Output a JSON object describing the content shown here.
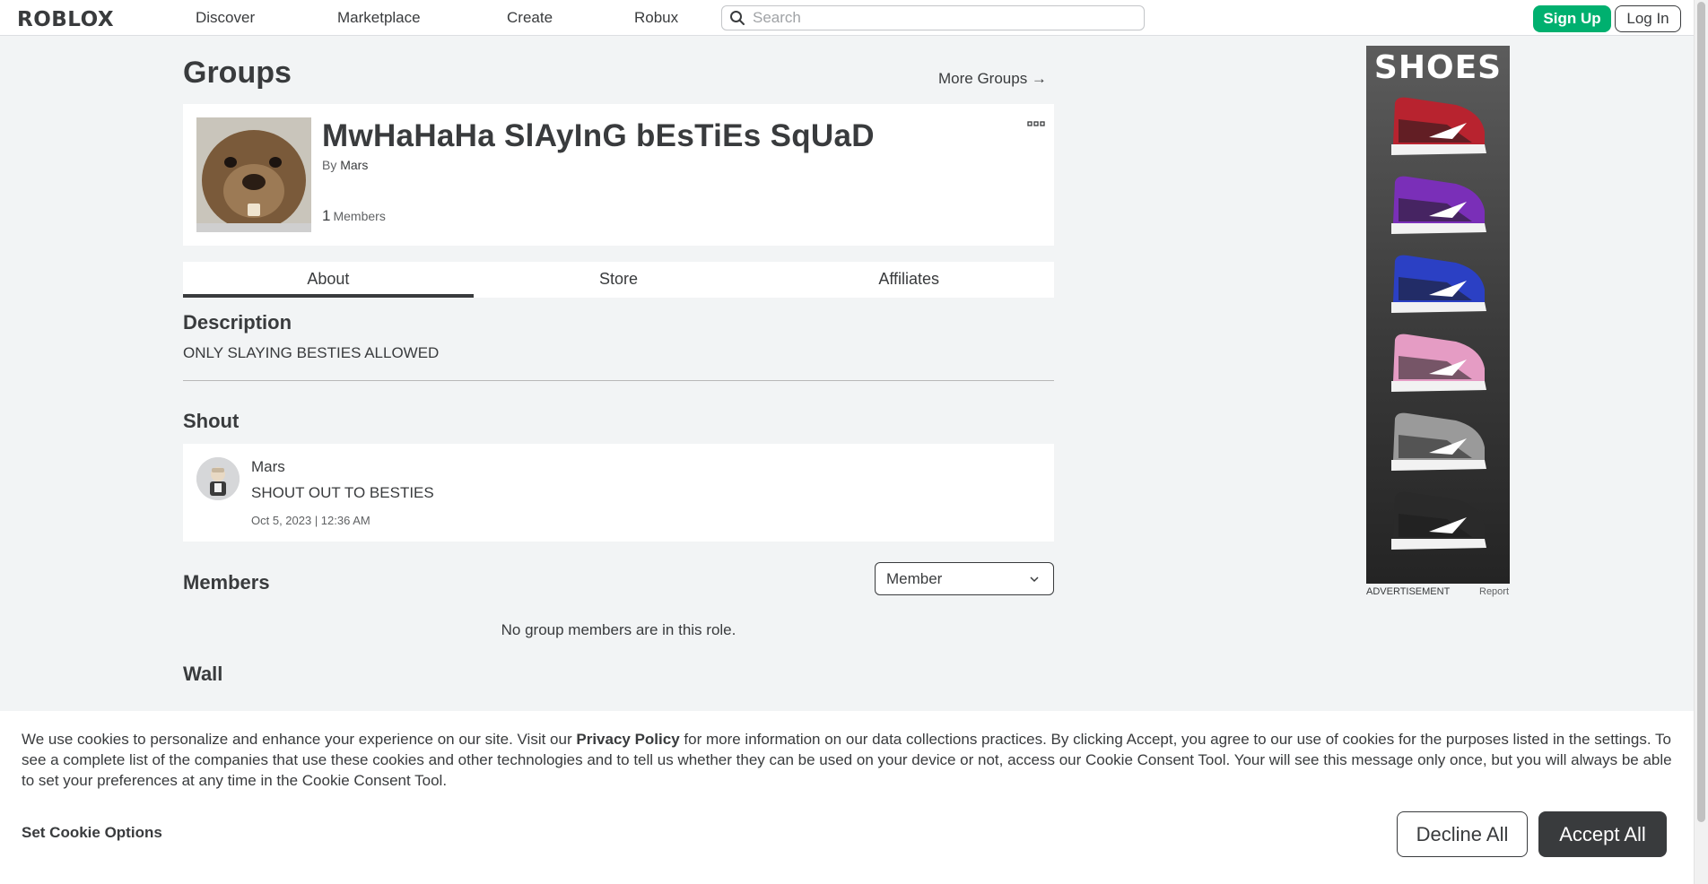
{
  "header": {
    "logo": "ROBLOX",
    "nav": [
      "Discover",
      "Marketplace",
      "Create",
      "Robux"
    ],
    "search_placeholder": "Search",
    "signup_label": "Sign Up",
    "login_label": "Log In"
  },
  "page": {
    "title": "Groups",
    "more_groups": "More Groups →"
  },
  "group": {
    "name": "MwHaHaHa SlAyInG bEsTiEs SqUaD",
    "by_prefix": "By",
    "owner": "Mars",
    "member_count": "1",
    "member_label": "Members"
  },
  "tabs": [
    {
      "label": "About",
      "active": true
    },
    {
      "label": "Store",
      "active": false
    },
    {
      "label": "Affiliates",
      "active": false
    }
  ],
  "description": {
    "heading": "Description",
    "text": "ONLY SLAYING BESTIES ALLOWED"
  },
  "shout": {
    "heading": "Shout",
    "poster": "Mars",
    "body": "SHOUT OUT TO BESTIES",
    "date": "Oct 5, 2023 | 12:36 AM"
  },
  "members": {
    "heading": "Members",
    "role_selected": "Member",
    "empty_text": "No group members are in this role."
  },
  "wall": {
    "heading": "Wall"
  },
  "ad": {
    "title": "SHOES",
    "label": "ADVERTISEMENT",
    "report": "Report",
    "shoe_colors": [
      "#b8232f",
      "#7a2fb8",
      "#2b40c4",
      "#e59cc4",
      "#9a9a9a",
      "#2a2a2a"
    ]
  },
  "cookie": {
    "text_before": "We use cookies to personalize and enhance your experience on our site. Visit our ",
    "policy_link": "Privacy Policy",
    "text_after": " for more information on our data collections practices. By clicking Accept, you agree to our use of cookies for the purposes listed in the settings. To see a complete list of the companies that use these cookies and other technologies and to tell us whether they can be used on your device or not, access our Cookie Consent Tool. Your will see this message only once, but you will always be able to set your preferences at any time in the Cookie Consent Tool.",
    "options_label": "Set Cookie Options",
    "decline_label": "Decline All",
    "accept_label": "Accept All"
  }
}
